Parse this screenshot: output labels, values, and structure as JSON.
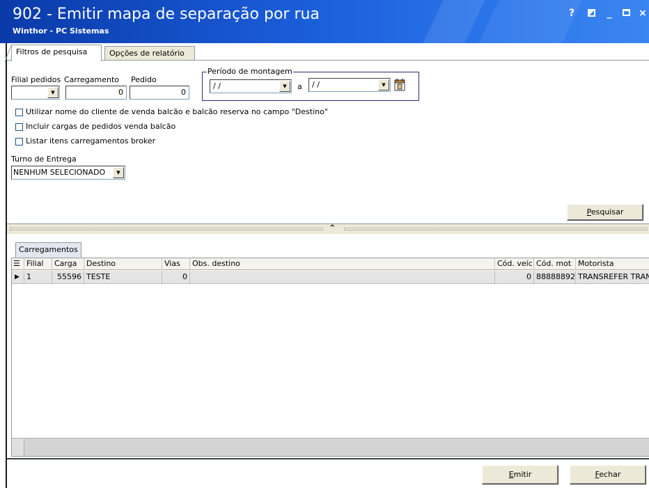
{
  "window": {
    "title": "902 - Emitir mapa de separação por rua",
    "subtitle": "Winthor - PC Sistemas",
    "controls": {
      "help": "?",
      "minimize": "_",
      "close": "×"
    }
  },
  "tabs": [
    {
      "label": "Filtros de pesquisa"
    },
    {
      "label": "Opções de relatório"
    }
  ],
  "filters": {
    "filial_label": "Filial pedidos",
    "filial_value": "",
    "carregamento_label": "Carregamento",
    "carregamento_value": "0",
    "pedido_label": "Pedido",
    "pedido_value": "0",
    "periodo_label": "Período de montagem",
    "periodo_start": "/ /",
    "periodo_sep": "a",
    "periodo_end": "/ /",
    "checkboxes": [
      {
        "label": "Utilizar nome do cliente de venda balcão e balcão reserva no campo \"Destino\"",
        "checked": false
      },
      {
        "label": "Incluir cargas de pedidos venda balcão",
        "checked": false
      },
      {
        "label": "Listar itens carregamentos broker",
        "checked": false
      }
    ],
    "turno_label": "Turno de Entrega",
    "turno_value": "NENHUM SELECIONADO",
    "search_button": {
      "accel": "P",
      "rest": "esquisar"
    }
  },
  "grid": {
    "tab_label": "Carregamentos",
    "columns": [
      "Filial",
      "Carga",
      "Destino",
      "Vias",
      "Obs. destino",
      "Cód. veíc",
      "Cód. mot",
      "Motorista"
    ],
    "rows": [
      {
        "filial": "1",
        "carga": "55596",
        "destino": "TESTE",
        "vias": "0",
        "obs": "",
        "cod_veic": "0",
        "cod_mot": "88888892",
        "motorista": "TRANSREFER TRAN"
      }
    ]
  },
  "footer": {
    "emitir": {
      "accel": "E",
      "rest": "mitir"
    },
    "fechar": {
      "accel": "F",
      "rest": "echar"
    }
  }
}
